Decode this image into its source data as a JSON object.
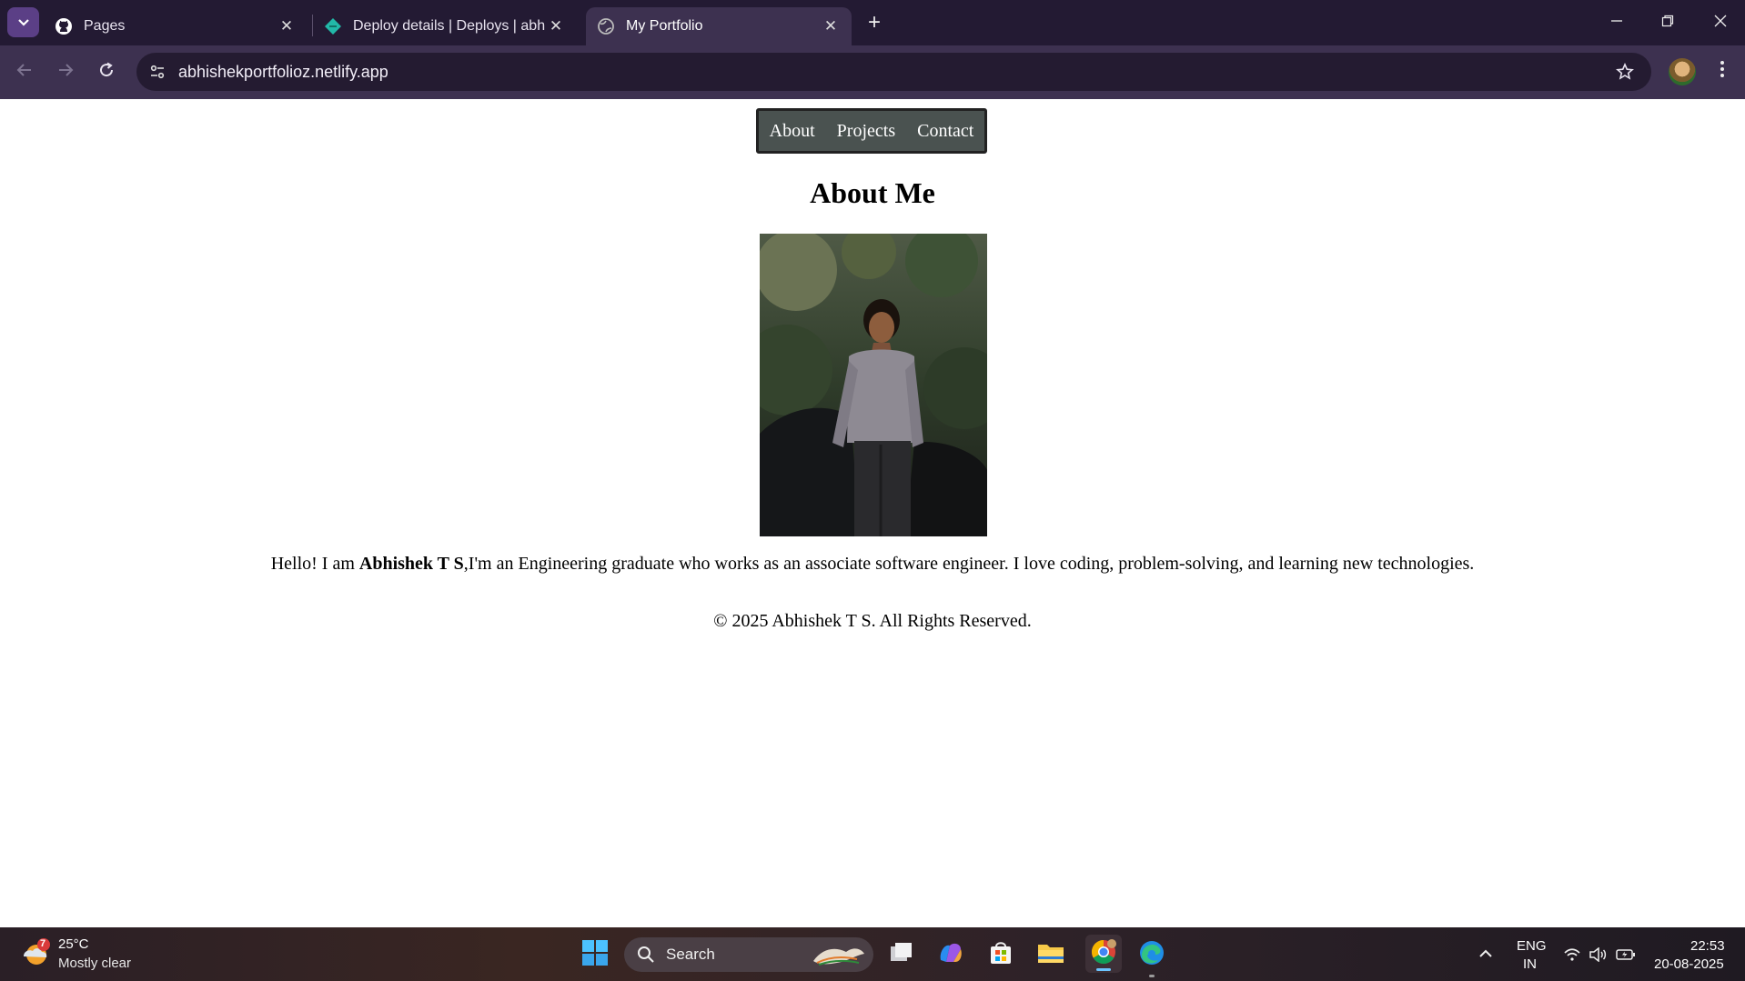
{
  "browser": {
    "tabs": [
      {
        "title": "Pages",
        "icon": "github-icon"
      },
      {
        "title": "Deploy details | Deploys | abhis",
        "icon": "netlify-icon"
      },
      {
        "title": "My Portfolio",
        "icon": "globe-icon",
        "active": true
      }
    ],
    "address": {
      "url": "abhishekportfolioz.netlify.app"
    }
  },
  "site": {
    "nav": [
      "About",
      "Projects",
      "Contact"
    ],
    "heading": "About Me",
    "intro": {
      "prefix": "Hello! I am ",
      "name": "Abhishek T S",
      "suffix": ",I'm an Engineering graduate who works as an associate software engineer. I love coding, problem-solving, and learning new technologies."
    },
    "footer": "© 2025 Abhishek T S. All Rights Reserved."
  },
  "taskbar": {
    "weather": {
      "temp": "25°C",
      "desc": "Mostly clear",
      "badge": "7"
    },
    "search_label": "Search",
    "language": {
      "line1": "ENG",
      "line2": "IN"
    },
    "clock": {
      "time": "22:53",
      "date": "20-08-2025"
    }
  },
  "colors": {
    "tabbar": "#231a33",
    "toolbar": "#3d3150",
    "nav_bg": "#4a5250"
  }
}
